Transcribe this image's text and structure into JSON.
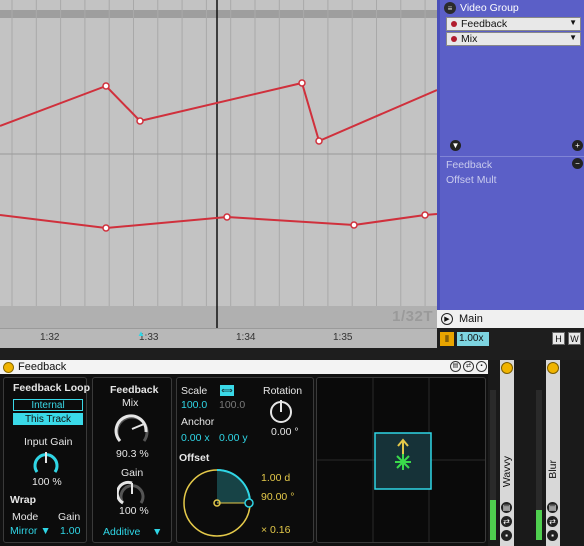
{
  "arrangement": {
    "grid_label": "1/32T",
    "ruler_labels": [
      "1:32",
      "1:33",
      "1:34",
      "1:35"
    ]
  },
  "clip_panel": {
    "title": "Video Group",
    "device_select": "Feedback",
    "param_select": "Mix",
    "envelopes": [
      "Feedback",
      "Offset Mult"
    ]
  },
  "track_row": {
    "name": "Main"
  },
  "zoom": {
    "value": "1.00x",
    "h_label": "H",
    "w_label": "W"
  },
  "device": {
    "title": "Feedback",
    "feedback_loop": {
      "title": "Feedback Loop",
      "internal_label": "Internal",
      "this_track_label": "This Track",
      "input_gain_label": "Input Gain",
      "input_gain_value": "100 %",
      "wrap_title": "Wrap",
      "mode_label": "Mode",
      "mode_value": "Mirror",
      "gain_label": "Gain",
      "gain_value": "1.00"
    },
    "feedback": {
      "title": "Feedback",
      "mix_label": "Mix",
      "mix_value": "90.3 %",
      "gain_label": "Gain",
      "gain_value": "100 %",
      "blend_value": "Additive"
    },
    "transform": {
      "scale_label": "Scale",
      "scale_x": "100.0",
      "scale_y": "100.0",
      "rotation_label": "Rotation",
      "rotation_value": "0.00 °",
      "anchor_label": "Anchor",
      "anchor_x": "0.00 x",
      "anchor_y": "0.00 y",
      "offset_label": "Offset",
      "offset_distance": "1.00 d",
      "offset_angle": "90.00 °",
      "offset_mult": "× 0.16"
    }
  },
  "rack": {
    "devices": [
      "Wavvy",
      "Blur"
    ]
  },
  "colors": {
    "accent_cyan": "#2fd6e6",
    "accent_yellow": "#e4c94a",
    "clip_blue": "#5b5fc7",
    "envelope_red": "#d0303c"
  }
}
